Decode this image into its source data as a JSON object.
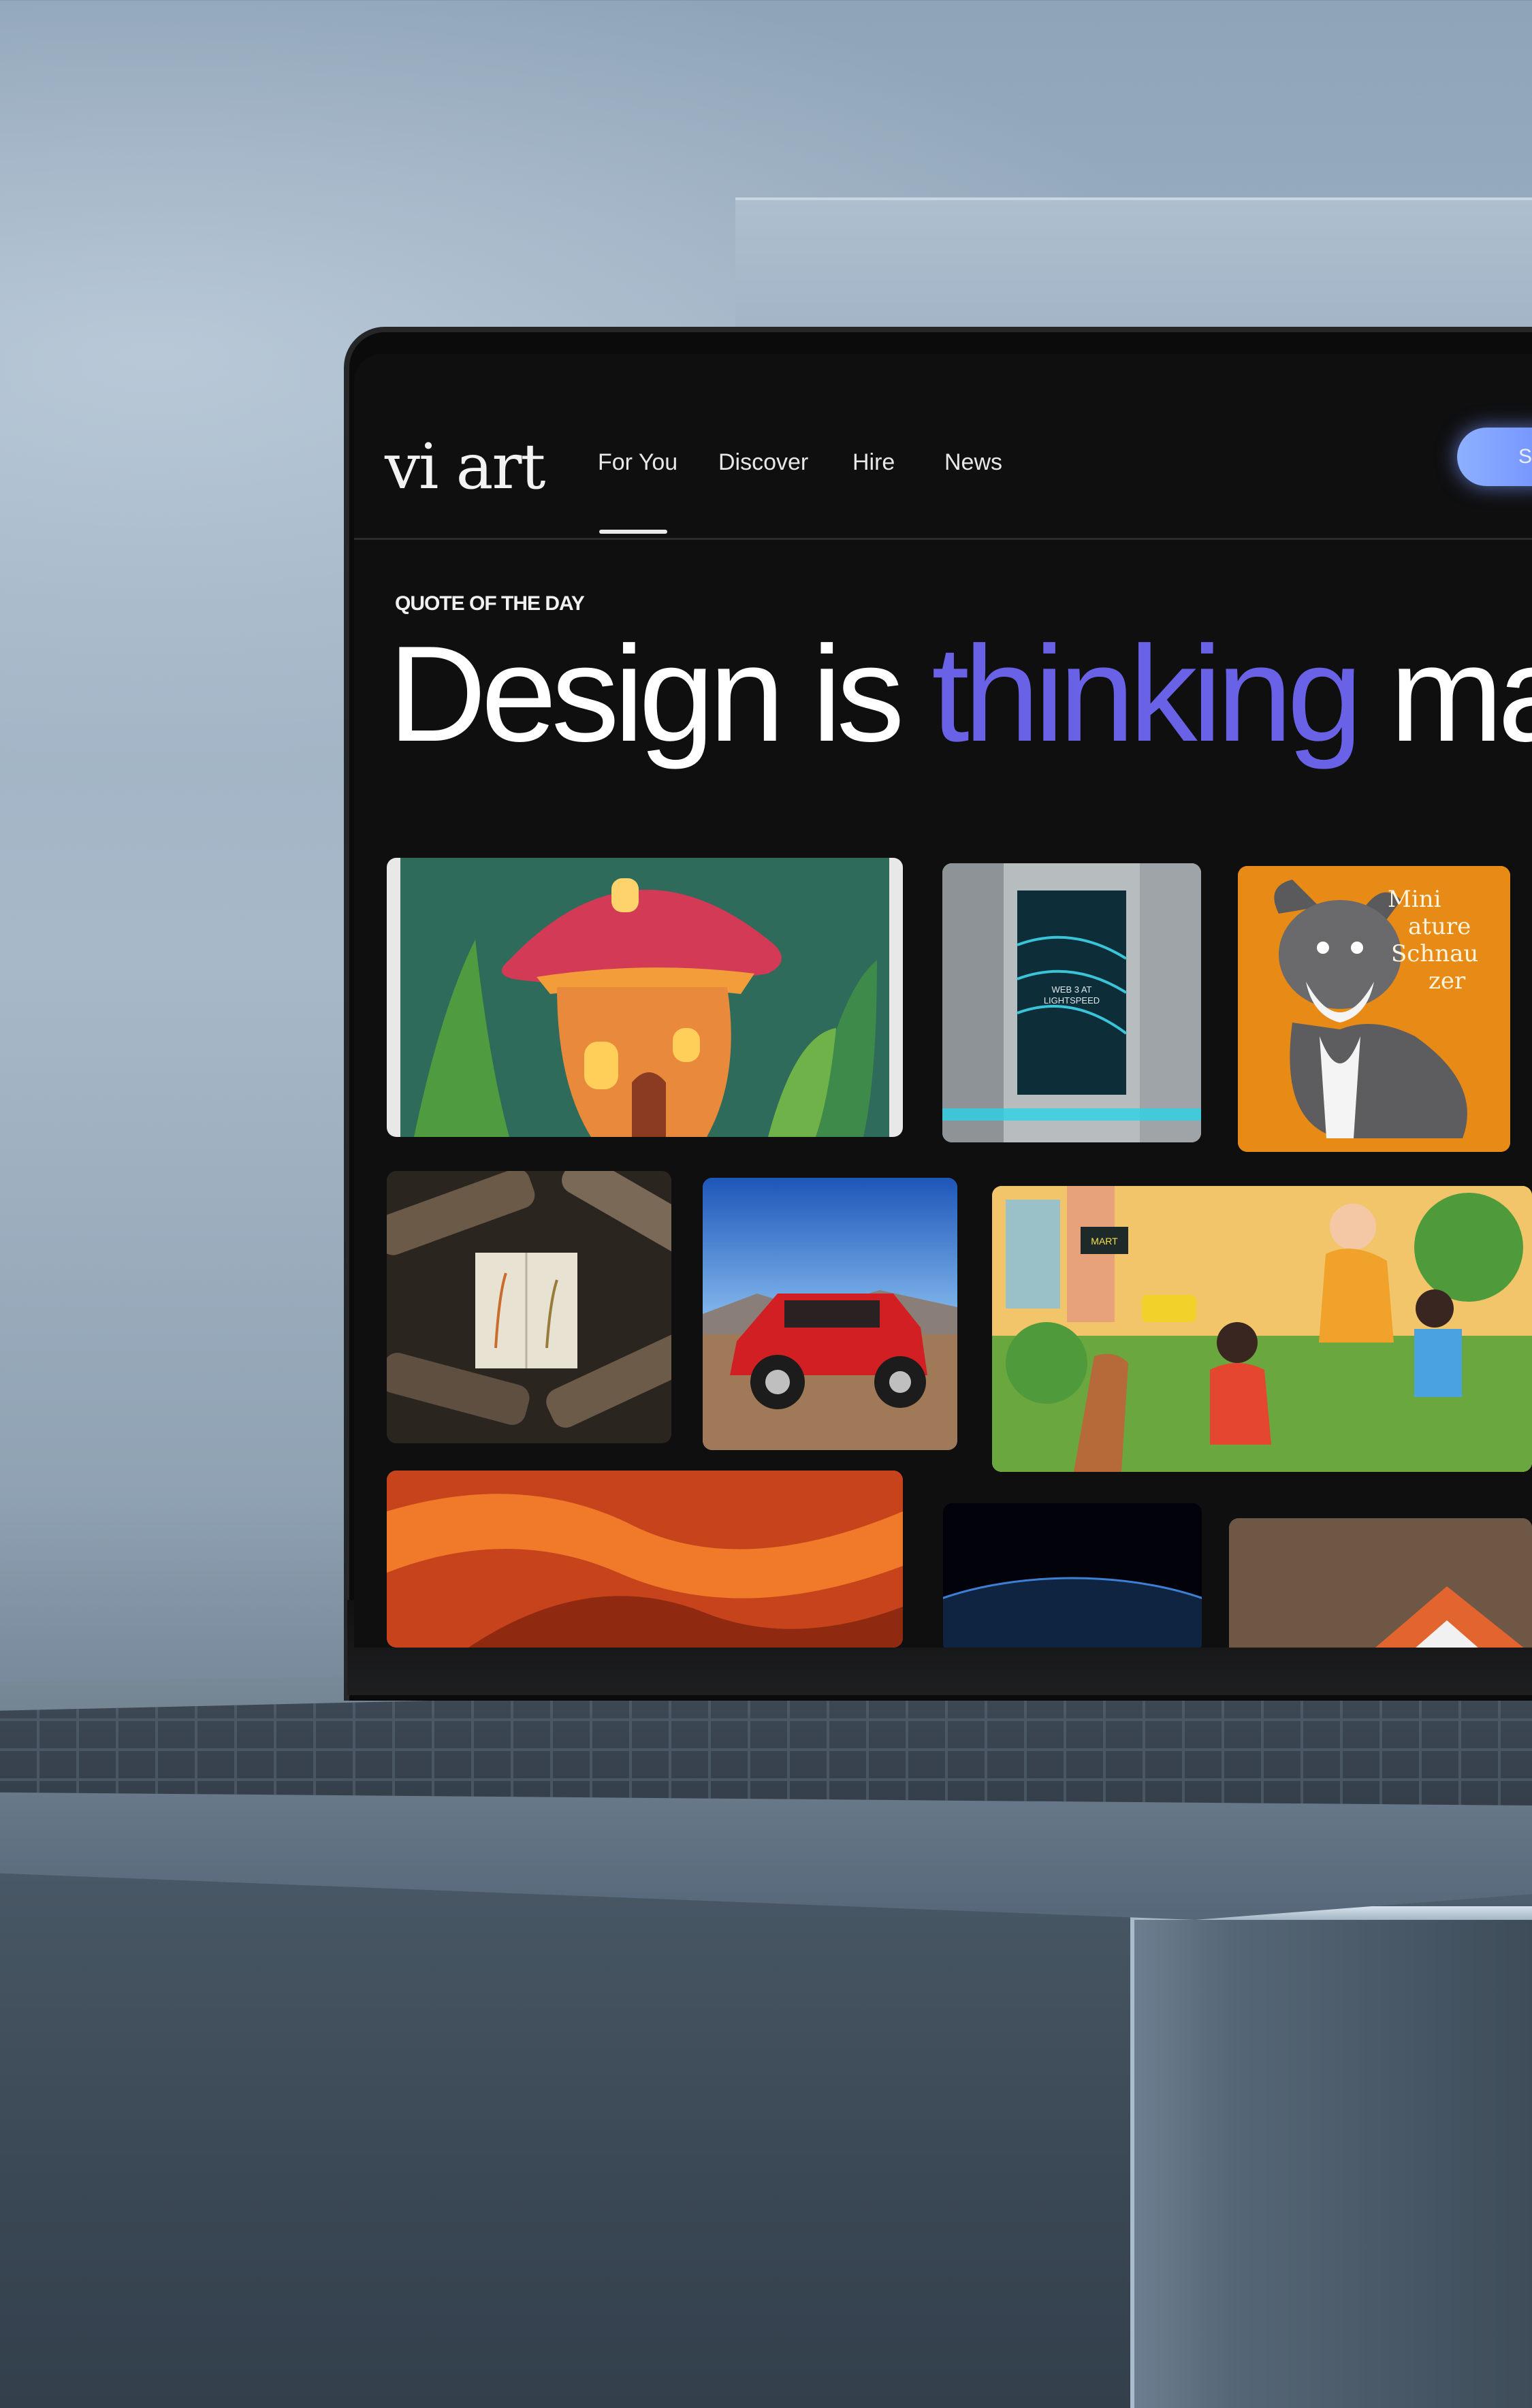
{
  "header": {
    "logo": "vi art",
    "nav": [
      {
        "label": "For You",
        "active": true
      },
      {
        "label": "Discover",
        "active": false
      },
      {
        "label": "Hire",
        "active": false
      },
      {
        "label": "News",
        "active": false
      }
    ],
    "cta_label": "Sh"
  },
  "hero": {
    "eyebrow": "QUOTE OF THE DAY",
    "headline_before": "Design is ",
    "headline_accent": "thinking",
    "headline_after": " made v"
  },
  "gallery": {
    "tiles": [
      {
        "subject": "mushroom-house-illustration"
      },
      {
        "subject": "corridor-render",
        "caption": "WEB 3 AT LIGHTSPEED"
      },
      {
        "subject": "schnauzer-illustration",
        "caption": "Mini ature Schnau zer"
      },
      {
        "subject": "wood-and-book-photo"
      },
      {
        "subject": "red-jeep-photo"
      },
      {
        "subject": "family-garden-illustration"
      },
      {
        "subject": "orange-fabric-render"
      },
      {
        "subject": "earth-night-render"
      },
      {
        "subject": "abstract-shape-render"
      }
    ]
  },
  "colors": {
    "accent": "#6a62e6",
    "screen_bg": "#0f0f10",
    "cta": "#7d9cff"
  }
}
